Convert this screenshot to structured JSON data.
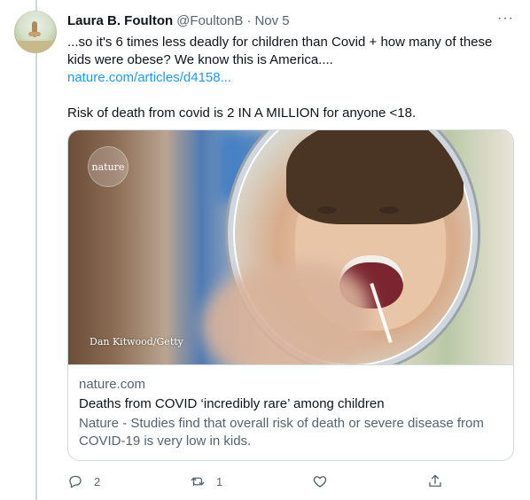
{
  "author": {
    "name": "Laura B. Foulton",
    "handle": "@FoultonB",
    "separator": "·",
    "date": "Nov 5"
  },
  "more_label": "···",
  "tweet": {
    "line1": "...so it's 6 times less deadly for children than Covid + how many of these kids were obese? We know this is America....",
    "link_text": "nature.com/articles/d4158...",
    "line2": "Risk of death from covid is 2 IN A MILLION for anyone <18."
  },
  "card": {
    "logo_text": "nature",
    "image_credit": "Dan Kitwood/Getty",
    "domain": "nature.com",
    "title": "Deaths from COVID ‘incredibly rare’ among children",
    "description": "Nature - Studies find that overall risk of death or severe disease from COVID-19 is very low in kids."
  },
  "actions": {
    "reply_count": "2",
    "retweet_count": "1",
    "like_count": "",
    "icons": [
      "reply-icon",
      "retweet-icon",
      "like-icon",
      "share-icon"
    ]
  },
  "colors": {
    "link": "#1d9bf0",
    "muted": "#536471",
    "border": "#cfd9de",
    "text": "#0f1419"
  }
}
